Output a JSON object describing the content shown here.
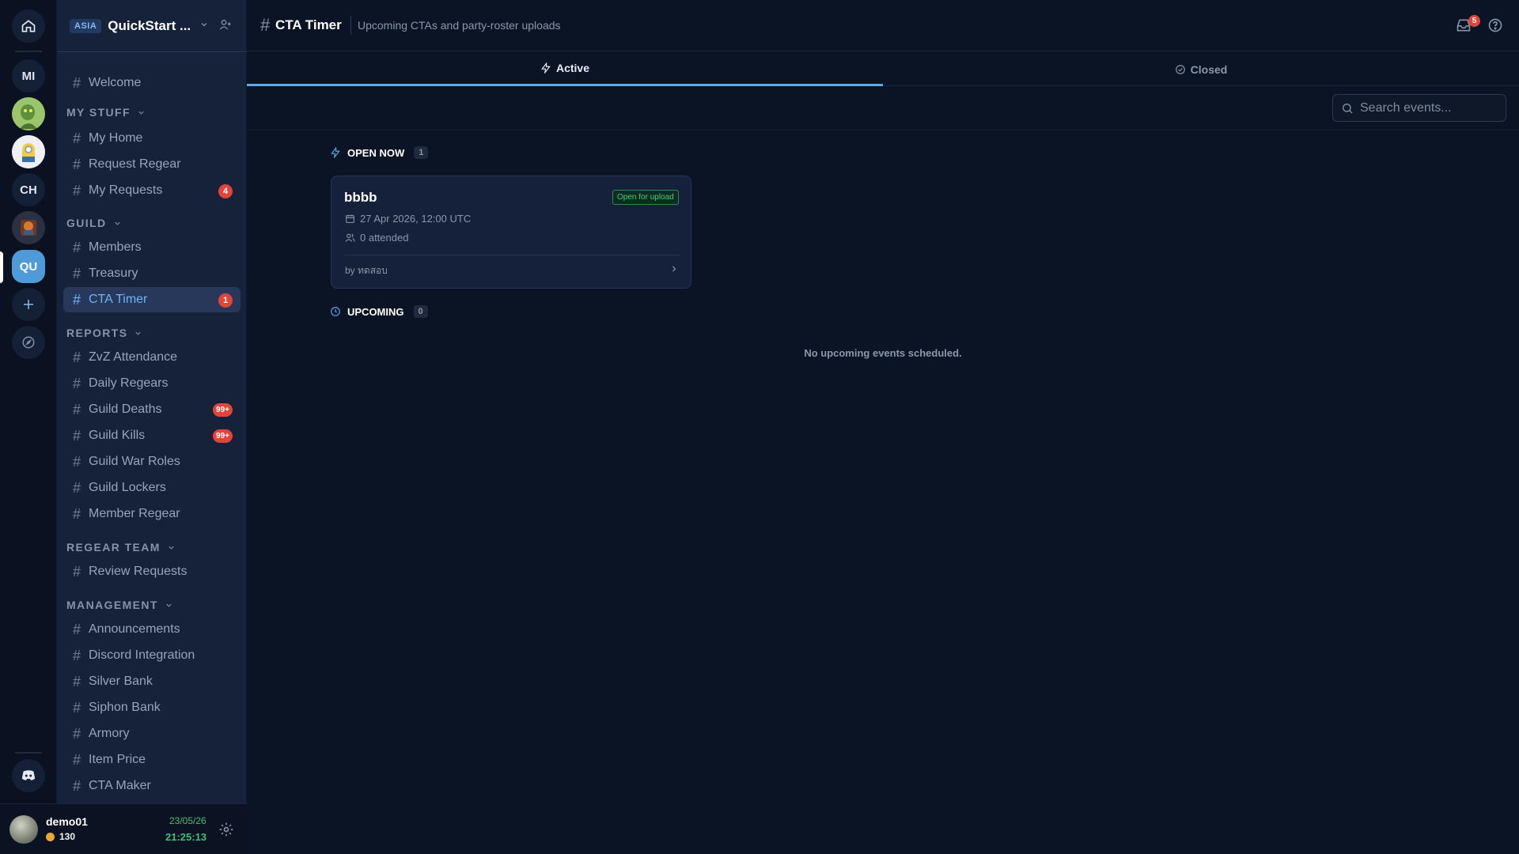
{
  "rail": {
    "servers": [
      {
        "initials": "MI"
      },
      {
        "initials": ""
      },
      {
        "initials": ""
      },
      {
        "initials": "CH"
      },
      {
        "initials": ""
      },
      {
        "initials": "QU",
        "active": true
      }
    ],
    "icons": [
      "home-icon",
      "plus-icon",
      "compass-icon",
      "discord-icon"
    ]
  },
  "sidebar": {
    "region": "ASIA",
    "guild_name": "QuickStart ...",
    "welcome": "Welcome",
    "sections": [
      {
        "title": "MY STUFF",
        "items": [
          {
            "label": "My Home"
          },
          {
            "label": "Request Regear"
          },
          {
            "label": "My Requests",
            "badge": "4"
          }
        ]
      },
      {
        "title": "GUILD",
        "items": [
          {
            "label": "Members"
          },
          {
            "label": "Treasury"
          },
          {
            "label": "CTA Timer",
            "badge": "1",
            "selected": true
          }
        ]
      },
      {
        "title": "REPORTS",
        "items": [
          {
            "label": "ZvZ Attendance"
          },
          {
            "label": "Daily Regears"
          },
          {
            "label": "Guild Deaths",
            "badge": "99+"
          },
          {
            "label": "Guild Kills",
            "badge": "99+"
          },
          {
            "label": "Guild War Roles"
          },
          {
            "label": "Guild Lockers"
          },
          {
            "label": "Member Regear"
          }
        ]
      },
      {
        "title": "REGEAR TEAM",
        "items": [
          {
            "label": "Review Requests"
          }
        ]
      },
      {
        "title": "MANAGEMENT",
        "items": [
          {
            "label": "Announcements"
          },
          {
            "label": "Discord Integration"
          },
          {
            "label": "Silver Bank"
          },
          {
            "label": "Siphon Bank"
          },
          {
            "label": "Armory"
          },
          {
            "label": "Item Price"
          },
          {
            "label": "CTA Maker"
          }
        ]
      }
    ]
  },
  "user": {
    "name": "demo01",
    "coins": "130",
    "date": "23/05/26",
    "time": "21:25:13"
  },
  "header": {
    "title": "CTA Timer",
    "description": "Upcoming CTAs and party-roster uploads",
    "inbox_count": "5"
  },
  "tabs": {
    "active": "Active",
    "closed": "Closed"
  },
  "search": {
    "placeholder": "Search events..."
  },
  "open_now": {
    "title": "OPEN NOW",
    "count": "1",
    "events": [
      {
        "name": "bbbb",
        "status": "Open for upload",
        "datetime": "27 Apr 2026, 12:00 UTC",
        "attended": "0 attended",
        "by": "by ทดสอบ"
      }
    ]
  },
  "upcoming": {
    "title": "UPCOMING",
    "count": "0",
    "empty_text": "No upcoming events scheduled."
  },
  "colors": {
    "accent": "#5fa8e6",
    "badge": "#e0453a",
    "status_green": "#3fcf7d",
    "selected_bg": "#27385a"
  }
}
